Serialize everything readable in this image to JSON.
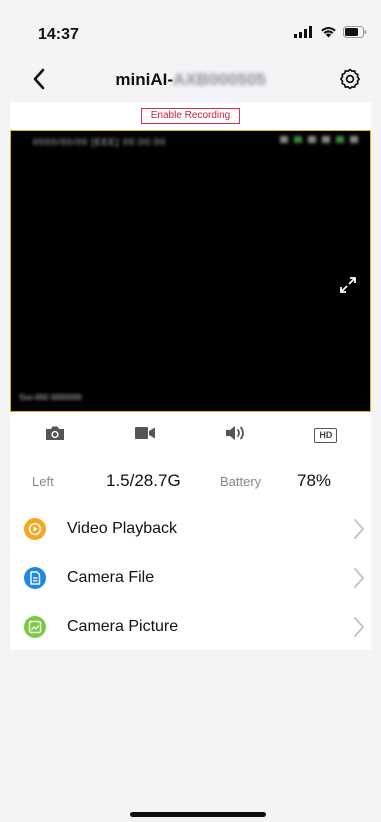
{
  "status_bar": {
    "time": "14:37"
  },
  "nav": {
    "title_prefix": "miniAI-",
    "title_device_id": "AXB000505",
    "back_icon": "chevron-left-icon",
    "settings_icon": "gear-icon"
  },
  "recording": {
    "label": "Enable Recording",
    "color": "#c51f3a"
  },
  "video": {
    "osd_text": "0000/00/00 [EEE] 00:00:00",
    "osd_bottom": "Sxx-000 0000000",
    "fullscreen_icon": "expand-icon",
    "border_color": "#e0b400"
  },
  "controls": [
    {
      "name": "snapshot",
      "icon": "camera-icon"
    },
    {
      "name": "record",
      "icon": "video-icon"
    },
    {
      "name": "audio",
      "icon": "speaker-icon"
    },
    {
      "name": "quality",
      "icon": "hd-icon",
      "label": "HD"
    }
  ],
  "stats": {
    "left_label": "Left",
    "left_value": "1.5/28.7G",
    "battery_label": "Battery",
    "battery_value": "78%"
  },
  "menu": [
    {
      "label": "Video Playback",
      "icon": "playback-icon",
      "color": "#f5a623"
    },
    {
      "label": "Camera File",
      "icon": "file-icon",
      "color": "#1e88e5"
    },
    {
      "label": "Camera Picture",
      "icon": "picture-icon",
      "color": "#7ac943"
    }
  ]
}
